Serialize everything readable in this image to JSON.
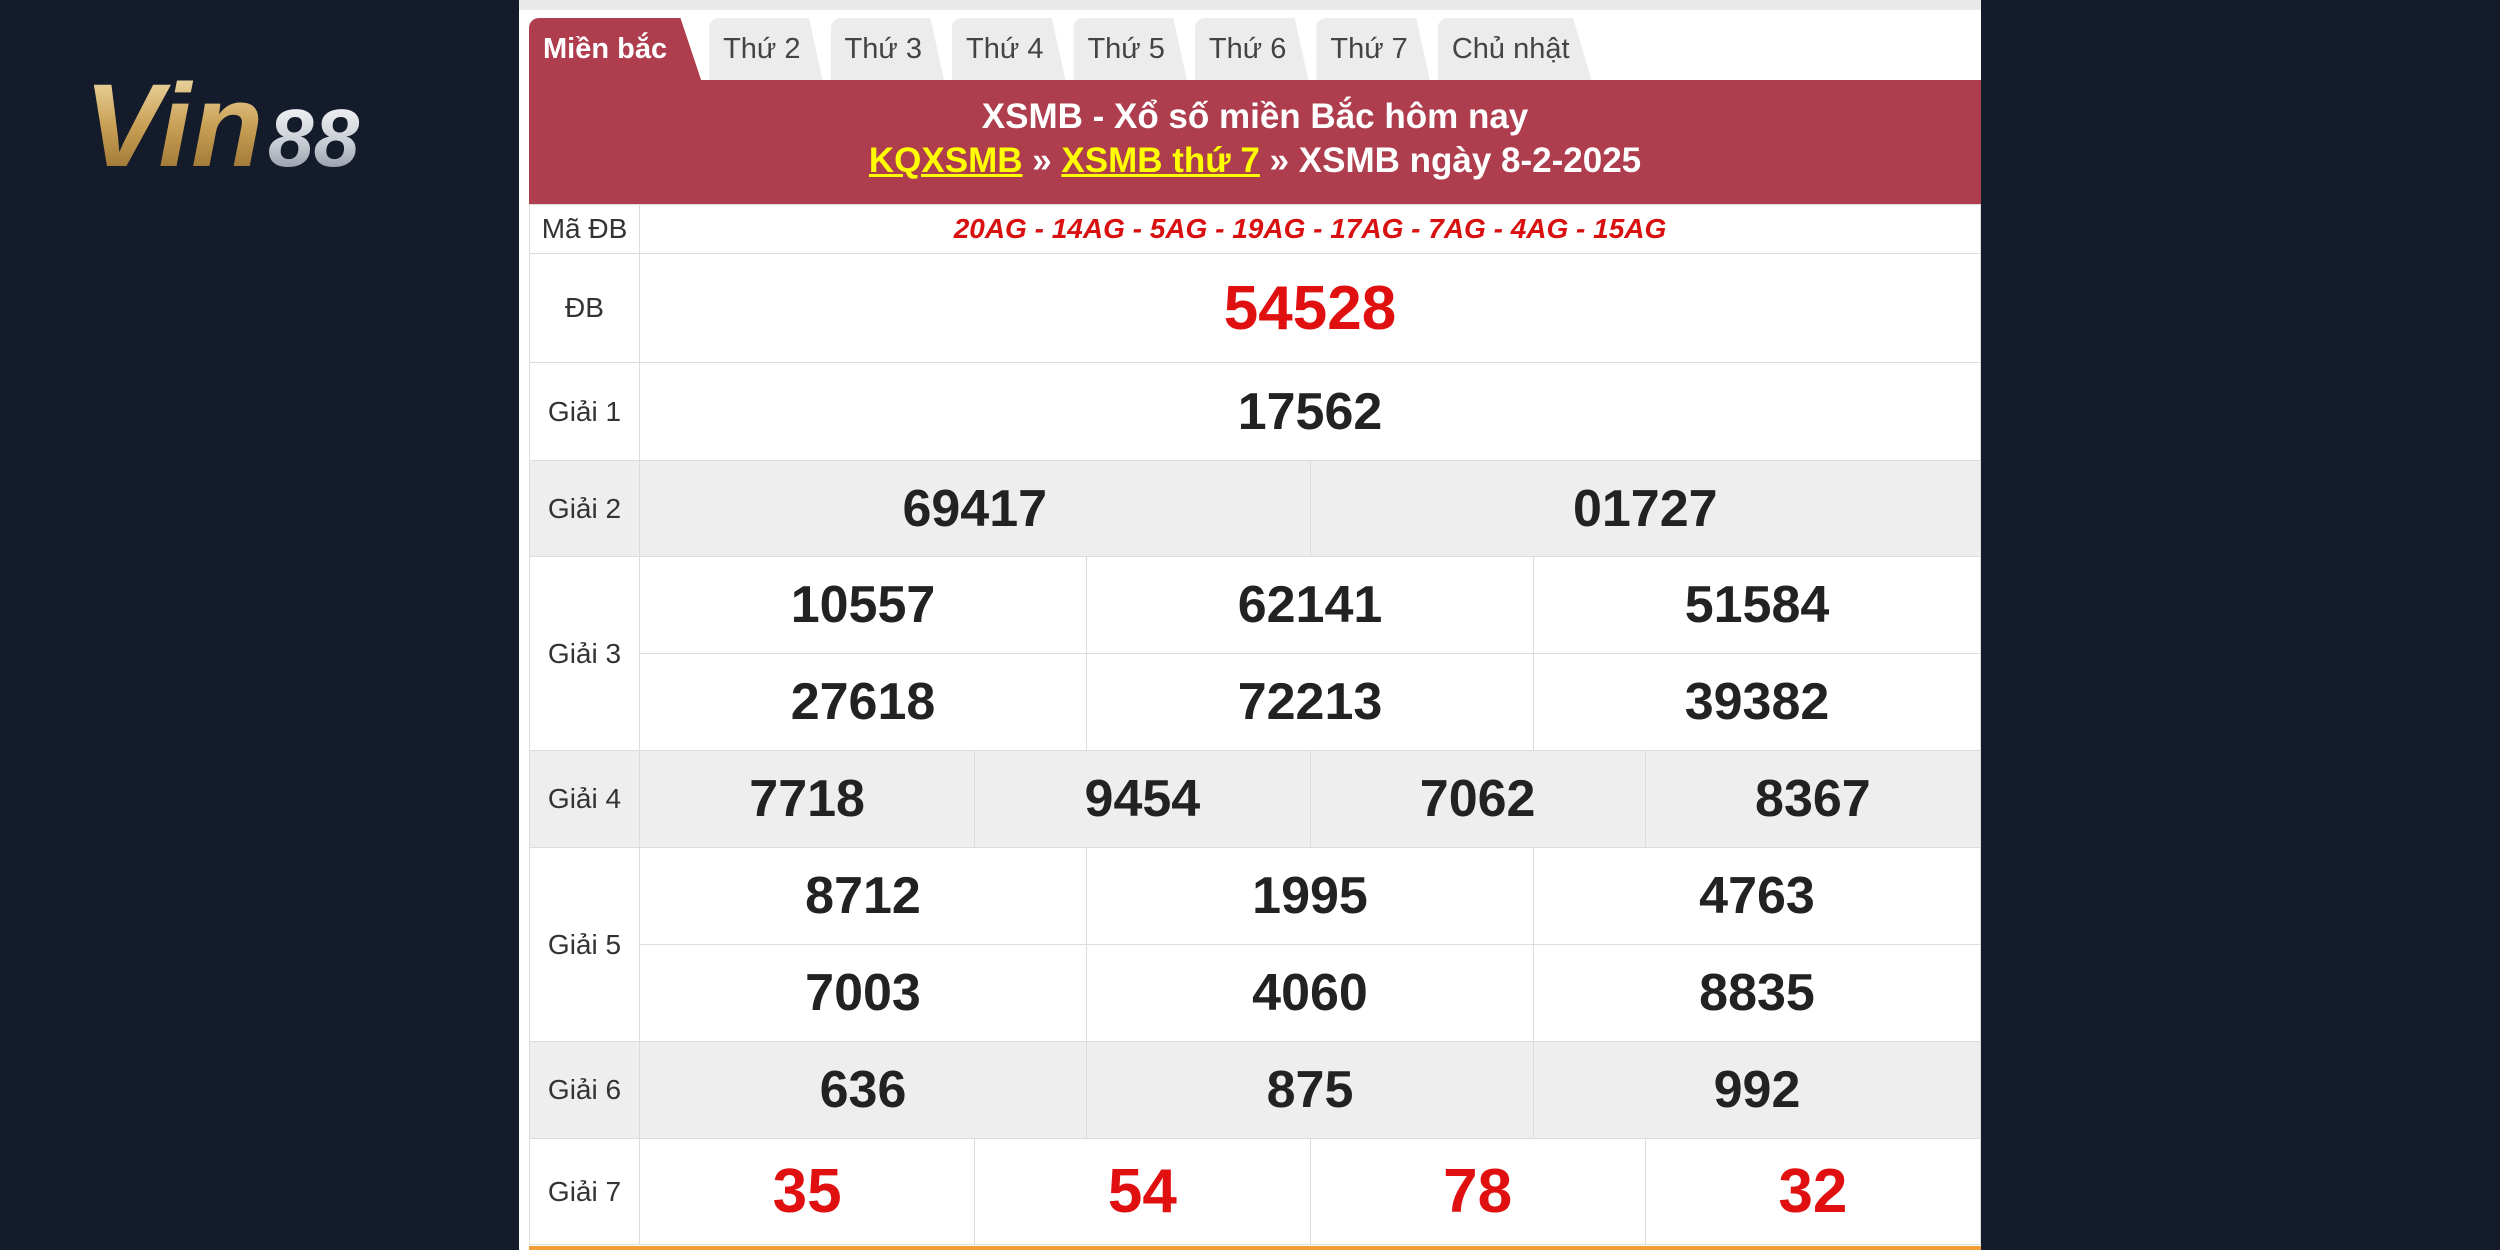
{
  "logo": {
    "text": "Vin88",
    "part1": "Vin",
    "part2": "88"
  },
  "tabs": [
    {
      "label": "Miền bắc",
      "active": true
    },
    {
      "label": "Thứ 2",
      "active": false
    },
    {
      "label": "Thứ 3",
      "active": false
    },
    {
      "label": "Thứ 4",
      "active": false
    },
    {
      "label": "Thứ 5",
      "active": false
    },
    {
      "label": "Thứ 6",
      "active": false
    },
    {
      "label": "Thứ 7",
      "active": false
    },
    {
      "label": "Chủ nhật",
      "active": false
    }
  ],
  "header": {
    "title": "XSMB - Xổ số miền Bắc hôm nay",
    "crumb_link1": "KQXSMB",
    "sep1": " » ",
    "crumb_link2": "XSMB thứ 7",
    "crumb_rest": " » XSMB ngày 8-2-2025"
  },
  "results": {
    "ma_db": {
      "label": "Mã ĐB",
      "value": "20AG - 14AG - 5AG - 19AG - 17AG - 7AG - 4AG - 15AG"
    },
    "db": {
      "label": "ĐB",
      "numbers": [
        "54528"
      ]
    },
    "g1": {
      "label": "Giải 1",
      "numbers": [
        "17562"
      ]
    },
    "g2": {
      "label": "Giải 2",
      "numbers": [
        "69417",
        "01727"
      ]
    },
    "g3": {
      "label": "Giải 3",
      "numbers": [
        "10557",
        "62141",
        "51584",
        "27618",
        "72213",
        "39382"
      ]
    },
    "g4": {
      "label": "Giải 4",
      "numbers": [
        "7718",
        "9454",
        "7062",
        "8367"
      ]
    },
    "g5": {
      "label": "Giải 5",
      "numbers": [
        "8712",
        "1995",
        "4763",
        "7003",
        "4060",
        "8835"
      ]
    },
    "g6": {
      "label": "Giải 6",
      "numbers": [
        "636",
        "875",
        "992"
      ]
    },
    "g7": {
      "label": "Giải 7",
      "numbers": [
        "35",
        "54",
        "78",
        "32"
      ]
    }
  },
  "colors": {
    "background": "#141c2b",
    "header_red": "#ae3d4e",
    "link_yellow": "#ffff00",
    "number_red": "#e01010"
  }
}
